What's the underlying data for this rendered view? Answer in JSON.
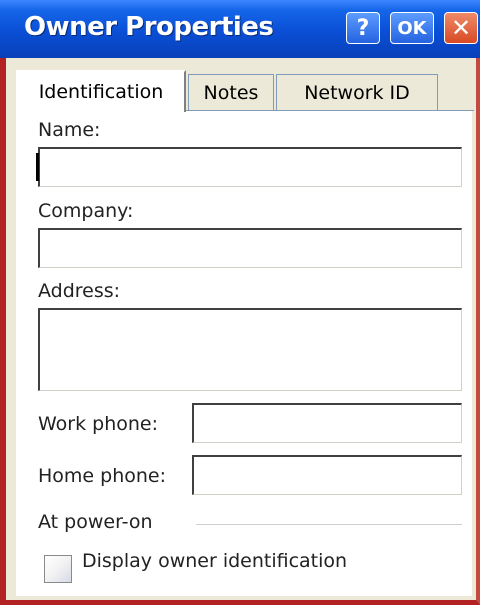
{
  "window": {
    "title": "Owner Properties"
  },
  "titlebar": {
    "help_label": "?",
    "ok_label": "OK",
    "close_label": "✕"
  },
  "tabs": [
    {
      "label": "Identification",
      "active": true
    },
    {
      "label": "Notes",
      "active": false
    },
    {
      "label": "Network ID",
      "active": false
    }
  ],
  "form": {
    "name": {
      "label": "Name:",
      "value": ""
    },
    "company": {
      "label": "Company:",
      "value": ""
    },
    "address": {
      "label": "Address:",
      "value": ""
    },
    "work_phone": {
      "label": "Work phone:",
      "value": ""
    },
    "home_phone": {
      "label": "Home phone:",
      "value": ""
    }
  },
  "power_on": {
    "section_label": "At power-on",
    "checkbox_label": "Display owner identification",
    "checked": false
  },
  "colors": {
    "title_bar": "#0a4fd6",
    "window_border": "#b22222",
    "close_button": "#d84a25"
  }
}
